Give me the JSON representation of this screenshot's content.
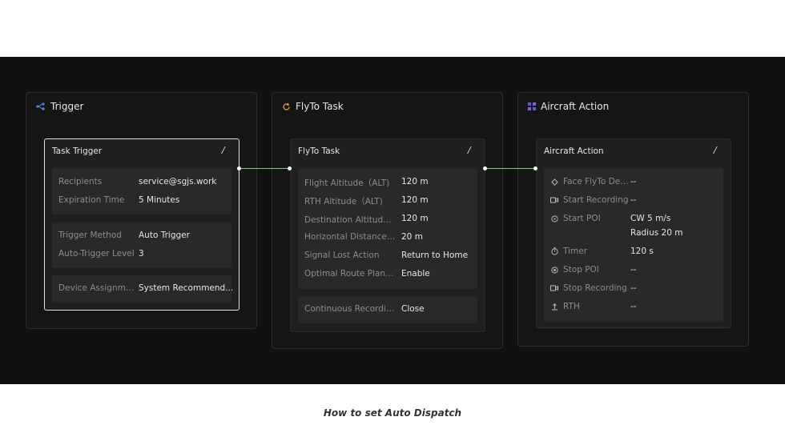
{
  "colors": {
    "connector": "#67d65c",
    "trigger_icon": "#4a86e8",
    "flyto_icon": "#e0a040",
    "action_icon": "#5a5ad8"
  },
  "trigger": {
    "lane_title": "Trigger",
    "card_title": "Task Trigger",
    "edit": "/",
    "groups": [
      [
        {
          "label": "Recipients",
          "value": "service@sgjs.work"
        },
        {
          "label": "Expiration Time",
          "value": "5 Minutes"
        }
      ],
      [
        {
          "label": "Trigger Method",
          "value": "Auto Trigger"
        },
        {
          "label": "Auto-Trigger Level",
          "value": "3"
        }
      ],
      [
        {
          "label": "Device Assignme...",
          "value": "System Recommend..."
        }
      ]
    ]
  },
  "flyto": {
    "lane_title": "FlyTo Task",
    "card_title": "FlyTo Task",
    "edit": "/",
    "rows": [
      {
        "label": "Flight Altitude（ALT)",
        "value": "120 m"
      },
      {
        "label": "RTH Altitude（ALT)",
        "value": "120 m"
      },
      {
        "label": "Destination Altitude（...",
        "value": "120 m"
      },
      {
        "label": "Horizontal Distance Fr...",
        "value": "20 m"
      },
      {
        "label": "Signal Lost Action",
        "value": "Return to Home"
      },
      {
        "label": "Optimal Route Planni...",
        "value": "Enable"
      }
    ],
    "recording": {
      "label": "Continuous Recording",
      "value": "Close"
    }
  },
  "action": {
    "lane_title": "Aircraft Action",
    "card_title": "Aircraft Action",
    "edit": "/",
    "rows": [
      {
        "icon": "face-target-icon",
        "label": "Face FlyTo Desti",
        "value": "--"
      },
      {
        "icon": "video-camera-icon",
        "label": "Start Recording",
        "value": "--"
      },
      {
        "icon": "poi-target-icon",
        "label": "Start POI",
        "value": "CW 5 m/s",
        "value2": "Radius 20 m"
      },
      {
        "icon": "timer-icon",
        "label": "Timer",
        "value": "120 s"
      },
      {
        "icon": "stop-poi-icon",
        "label": "Stop POI",
        "value": "--"
      },
      {
        "icon": "video-camera-icon",
        "label": "Stop Recording",
        "value": "--"
      },
      {
        "icon": "rth-icon",
        "label": "RTH",
        "value": "--"
      }
    ]
  },
  "caption": "How to set Auto Dispatch"
}
